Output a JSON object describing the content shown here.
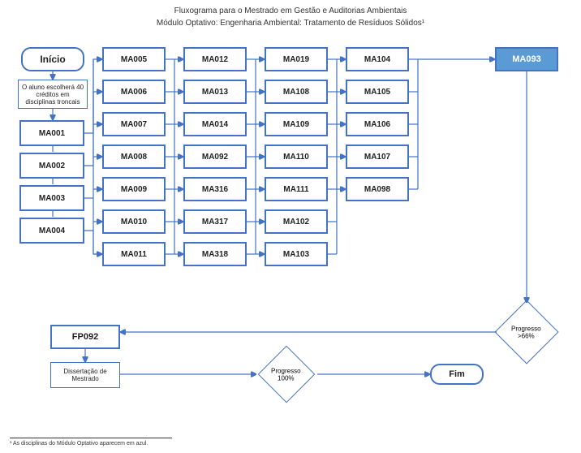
{
  "title": "Fluxograma para o Mestrado em Gestão e Auditorias Ambientais",
  "subtitle": "Módulo Optativo: Engenharia Ambiental: Tratamento de Resíduos Sólidos¹",
  "start": "Início",
  "note": "O aluno escolherá 40 créditos em disciplinas troncais",
  "col1": [
    "MA001",
    "MA002",
    "MA003",
    "MA004"
  ],
  "col2": [
    "MA005",
    "MA006",
    "MA007",
    "MA008",
    "MA009",
    "MA010",
    "MA011"
  ],
  "col3": [
    "MA012",
    "MA013",
    "MA014",
    "MA092",
    "MA316",
    "MA317",
    "MA318"
  ],
  "col4": [
    "MA019",
    "MA108",
    "MA109",
    "MA110",
    "MA111",
    "MA102",
    "MA103"
  ],
  "col5": [
    "MA104",
    "MA105",
    "MA106",
    "MA107",
    "MA098"
  ],
  "highlighted": "MA093",
  "fp": "FP092",
  "dissertation": "Dissertação de Mestrado",
  "end": "Fim",
  "diamond1": "Progresso >66%",
  "diamond2": "Progresso 100%",
  "footnote": "¹  As disciplinas do Módulo Optativo aparecem em azul."
}
